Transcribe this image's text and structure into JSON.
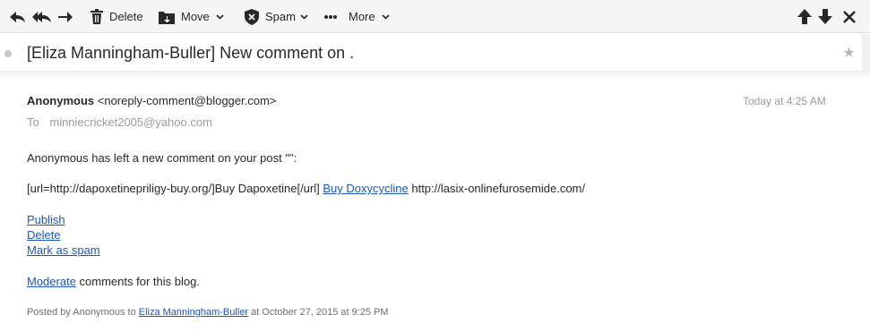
{
  "toolbar": {
    "delete_label": "Delete",
    "move_label": "Move",
    "spam_label": "Spam",
    "more_label": "More",
    "icons": [
      "reply-icon",
      "reply-all-icon",
      "forward-icon",
      "trash-icon",
      "folder-move-icon",
      "spam-shield-icon",
      "more-dots-icon",
      "arrow-up-icon",
      "arrow-down-icon",
      "close-icon",
      "star-icon"
    ]
  },
  "subject": "[Eliza Manningham-Buller] New comment on .",
  "message": {
    "sender_name": "Anonymous",
    "sender_email": "<noreply-comment@blogger.com>",
    "date": "Today at 4:25 AM",
    "to_label": "To",
    "to_address": "minniecricket2005@yahoo.com",
    "intro": "Anonymous has left a new comment on your post \"\":",
    "comment_prefix": "[url=http://dapoxetinepriligy-buy.org/]Buy Dapoxetine[/url] ",
    "comment_link": "Buy Doxycycline",
    "comment_suffix": " http://lasix-onlinefurosemide.com/",
    "action_publish": "Publish",
    "action_delete": "Delete",
    "action_spam": "Mark as spam",
    "moderate_link": "Moderate",
    "moderate_text": " comments for this blog.",
    "footer_prefix": "Posted by Anonymous to ",
    "footer_link": "Eliza Manningham-Buller",
    "footer_suffix": " at October 27, 2015 at 9:25 PM"
  },
  "colors": {
    "link": "#1d55b8",
    "muted": "#979ba7",
    "toolbar_bg": "#f5f5f5",
    "icon": "#26282a"
  }
}
